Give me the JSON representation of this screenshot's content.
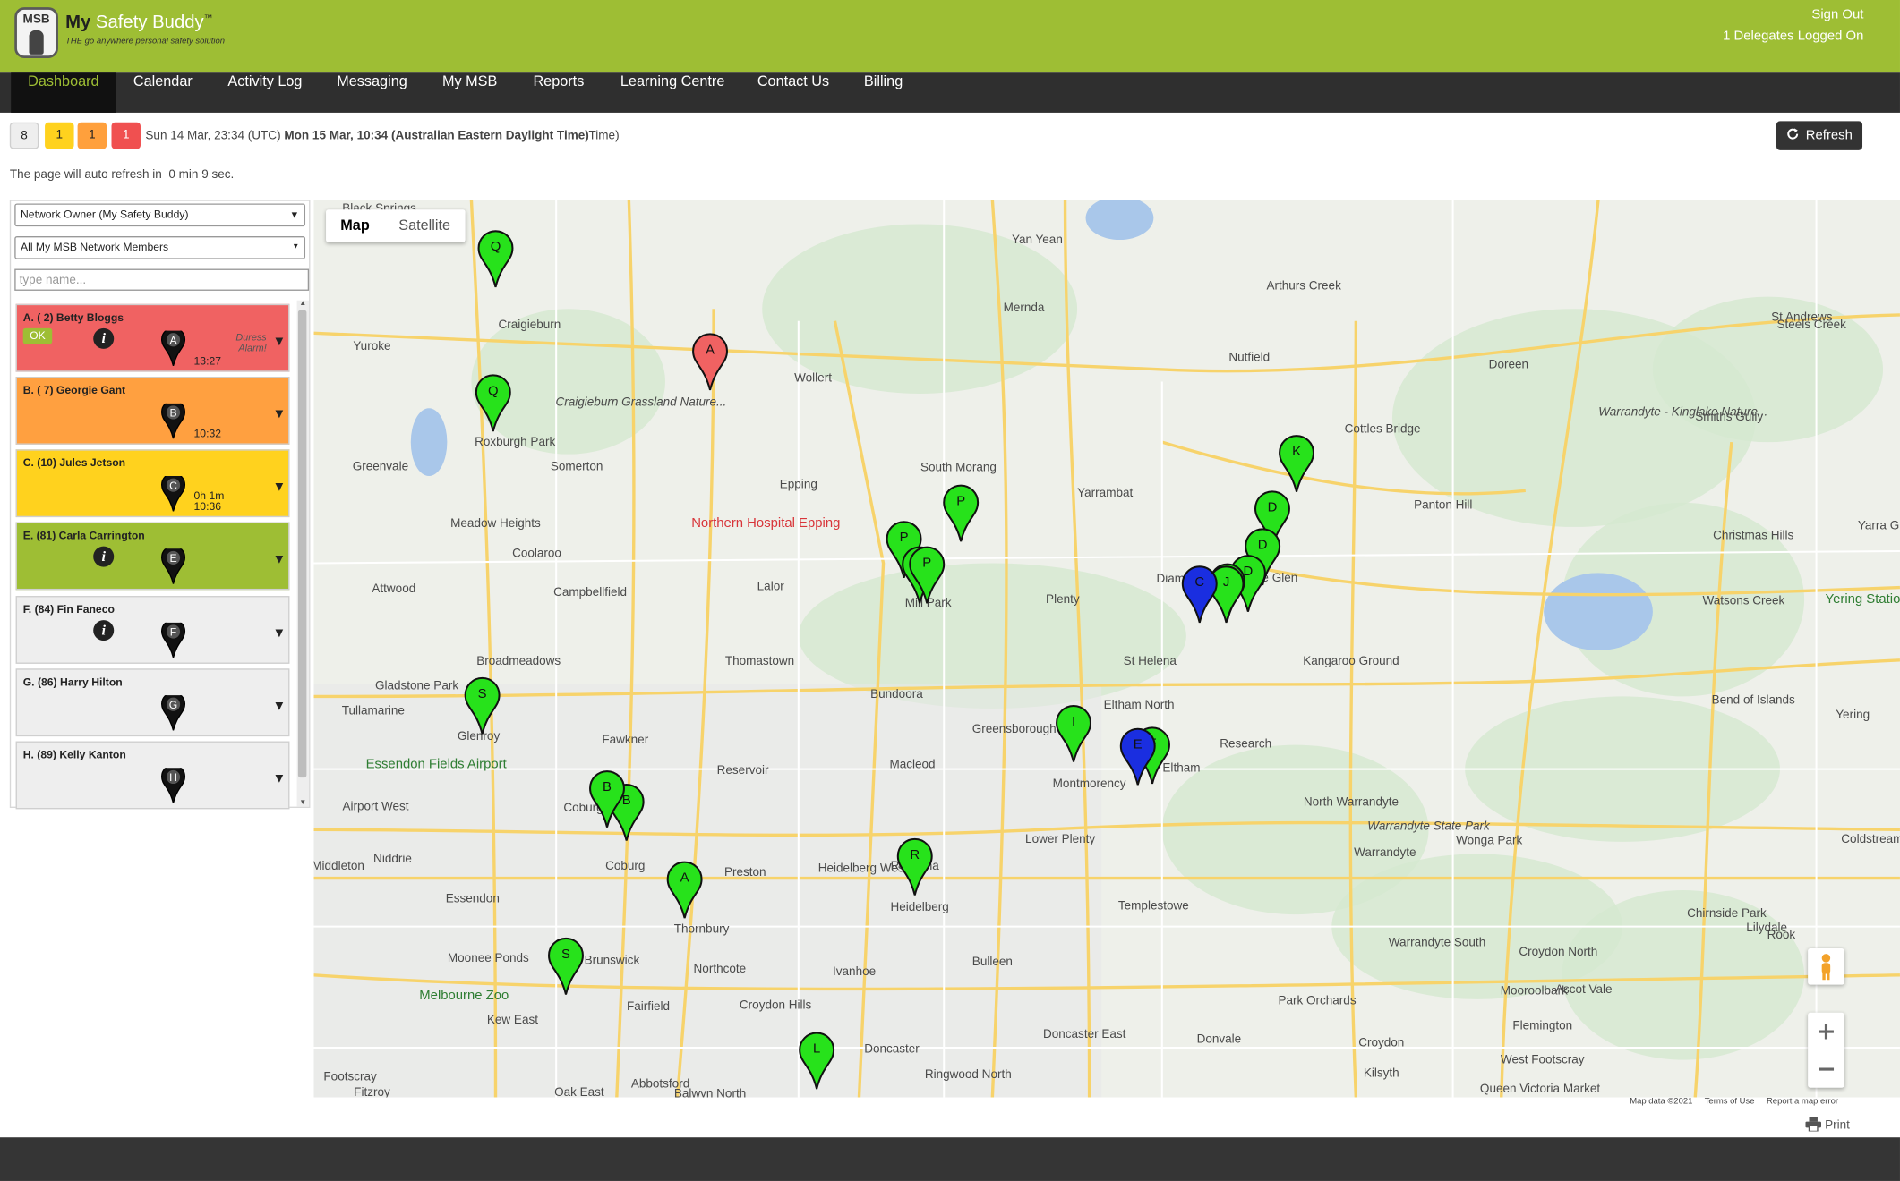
{
  "header": {
    "logo_text": "MSB",
    "brand_primary": "My",
    "brand_secondary": "Safety Buddy",
    "trademark": "™",
    "tagline": "THE go anywhere personal safety solution",
    "sign_out": "Sign Out",
    "delegates": "1 Delegates Logged On"
  },
  "nav": {
    "items": [
      "Dashboard",
      "Calendar",
      "Activity Log",
      "Messaging",
      "My MSB",
      "Reports",
      "Learning Centre",
      "Contact Us",
      "Billing"
    ],
    "active": "Dashboard"
  },
  "status": {
    "counts": [
      "8",
      "1",
      "1",
      "1"
    ],
    "time_utc": "Sun 14 Mar, 23:34 (UTC)",
    "time_local": "Mon 15 Mar, 10:34 (Australian Eastern Daylight Time)",
    "time_suffix": "Time)",
    "refresh_label": "Refresh",
    "auto_refresh_prefix": "The page will auto refresh in",
    "auto_refresh_value": "0 min 9 sec."
  },
  "sidebar": {
    "owner_select": "Network Owner (My Safety Buddy)",
    "members_select": "All My MSB Network Members",
    "search_placeholder": "type name...",
    "members": [
      {
        "name": "A. ( 2) Betty Bloggs",
        "pin": "A",
        "ok_label": "OK",
        "time": "13:27",
        "alarm": "Duress Alarm!"
      },
      {
        "name": "B. ( 7) Georgie Gant",
        "pin": "B",
        "time": "10:32"
      },
      {
        "name": "C. (10) Jules Jetson",
        "pin": "C",
        "time_line1": "0h 1m",
        "time_line2": "10:36"
      },
      {
        "name": "E. (81) Carla Carrington",
        "pin": "E"
      },
      {
        "name": "F. (84) Fin Faneco",
        "pin": "F"
      },
      {
        "name": "G. (86) Harry Hilton",
        "pin": "G"
      },
      {
        "name": "H. (89) Kelly Kanton",
        "pin": "H"
      }
    ]
  },
  "map": {
    "type_options": [
      "Map",
      "Satellite"
    ],
    "selected_type": "Map",
    "places": [
      "Yan Yean",
      "Mernda",
      "Arthurs Creek",
      "St Andrews",
      "Steels Creek",
      "Craigieburn",
      "Yuroke",
      "Wollert",
      "Craigieburn Grassland Nature...",
      "Doreen",
      "Nutfield",
      "Cottles Bridge",
      "Smiths Gully",
      "Warrandyte - Kinglake Nature...",
      "Roxburgh Park",
      "Somerton",
      "Greenvale",
      "South Morang",
      "Epping",
      "Yarrambat",
      "Panton Hill",
      "Christmas Hills",
      "Yarra Glen",
      "Northern Hospital Epping",
      "Meadow Heights",
      "Coolaroo",
      "Attwood",
      "Campbellfield",
      "Lalor",
      "Mill Park",
      "Plenty",
      "Diamond Creek",
      "Wattle Glen",
      "Watsons Creek",
      "Yering Station Winery",
      "Broadmeadows",
      "Thomastown",
      "St Helena",
      "Kangaroo Ground",
      "Gladstone Park",
      "Tullamarine",
      "Glenroy",
      "Fawkner",
      "Bundoora",
      "Greensborough",
      "Eltham North",
      "Research",
      "Bend of Islands",
      "Yering",
      "Essendon Fields Airport",
      "Reservoir",
      "Macleod",
      "Eltham",
      "Montmorency",
      "Coburg North",
      "Airport West",
      "Niddrie",
      "Coburg",
      "Preston",
      "Heidelberg West",
      "Rosanna",
      "Lower Plenty",
      "North Warrandyte",
      "Warrandyte State Park",
      "Wonga Park",
      "Coldstream",
      "Essendon",
      "Heidelberg",
      "Thornbury",
      "Templestowe",
      "Warrandyte",
      "Warrandyte South",
      "Chirnside Park",
      "Lilydale",
      "Moonee Ponds",
      "Brunswick",
      "Northcote",
      "Ivanhoe",
      "Bulleen",
      "Park Orchards",
      "Croydon North",
      "Ascot Vale",
      "Melbourne Zoo",
      "Fairfield",
      "Croydon Hills",
      "Mooroolbark",
      "Flemington",
      "Kew East",
      "Doncaster",
      "Doncaster East",
      "Donvale",
      "Croydon",
      "West Footscray",
      "Footscray",
      "Fitzroy",
      "Abbotsford",
      "Balwyn North",
      "Ringwood North",
      "Kilsyth",
      "Queen Victoria Market",
      "Oak East",
      "Middleton",
      "Black Springs",
      "Rook"
    ],
    "markers": [
      {
        "letter": "Q",
        "color": "green"
      },
      {
        "letter": "Q",
        "color": "green"
      },
      {
        "letter": "A",
        "color": "red"
      },
      {
        "letter": "P",
        "color": "green"
      },
      {
        "letter": "P",
        "color": "green"
      },
      {
        "letter": "P",
        "color": "green"
      },
      {
        "letter": "P",
        "color": "green"
      },
      {
        "letter": "K",
        "color": "green"
      },
      {
        "letter": "D",
        "color": "green"
      },
      {
        "letter": "D",
        "color": "green"
      },
      {
        "letter": "D",
        "color": "green"
      },
      {
        "letter": "D",
        "color": "green"
      },
      {
        "letter": "J",
        "color": "green"
      },
      {
        "letter": "C",
        "color": "blue"
      },
      {
        "letter": "S",
        "color": "green"
      },
      {
        "letter": "I",
        "color": "green"
      },
      {
        "letter": "F",
        "color": "green"
      },
      {
        "letter": "E",
        "color": "blue"
      },
      {
        "letter": "B",
        "color": "green"
      },
      {
        "letter": "B",
        "color": "green"
      },
      {
        "letter": "A",
        "color": "green"
      },
      {
        "letter": "R",
        "color": "green"
      },
      {
        "letter": "S",
        "color": "green"
      },
      {
        "letter": "L",
        "color": "green"
      }
    ],
    "street_view_label": "Street View",
    "zoom_in": "+",
    "zoom_out": "−",
    "attribution": {
      "data": "Map data ©2021",
      "terms": "Terms of Use",
      "report": "Report a map error"
    }
  },
  "print_label": "Print",
  "colors": {
    "brand_green": "#9ebe34",
    "nav_dark": "#2f2f2f",
    "alarm_red": "#f06262",
    "warn_orange": "#ffa040",
    "caution_yellow": "#ffd21e",
    "marker_green": "#27e21b",
    "marker_blue": "#1a2ee0"
  }
}
